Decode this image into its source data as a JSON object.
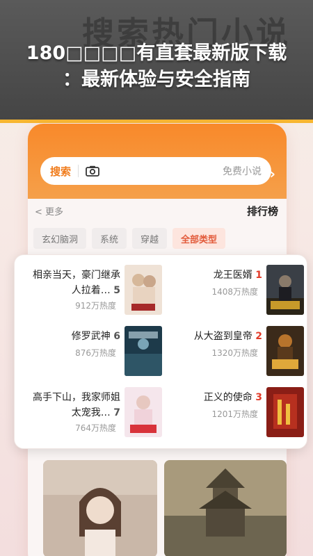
{
  "banner": {
    "ghost_text": "搜索热门小说",
    "title_line1": "180□□□□有直套最新版下载",
    "title_line2": "：最新体验与安全指南"
  },
  "search": {
    "button_label": "搜索",
    "placeholder": "免费小说",
    "back_glyph": "›",
    "camera_icon": "camera-icon"
  },
  "ranking": {
    "more_label": "< 更多",
    "title": "排行榜"
  },
  "tabs": [
    "全部类型",
    "穿越",
    "系统",
    "玄幻脑洞"
  ],
  "books": [
    {
      "rank": "1",
      "title": "龙王医婿",
      "heat": "1408万热度"
    },
    {
      "rank": "2",
      "title": "从大盗到皇帝",
      "heat": "1320万热度"
    },
    {
      "rank": "3",
      "title": "正义的使命",
      "heat": "1201万热度"
    },
    {
      "rank": "5",
      "title": "相亲当天，豪门继承人拉着…",
      "heat": "912万热度"
    },
    {
      "rank": "6",
      "title": "修罗武神",
      "heat": "876万热度"
    },
    {
      "rank": "7",
      "title": "高手下山，我家师姐太宠我…",
      "heat": "764万热度"
    }
  ],
  "colors": {
    "accent": "#f5892a",
    "rank_top": "#e23c2a",
    "banner_bg": "#4b4b4b",
    "stripe": "#f7b631"
  }
}
